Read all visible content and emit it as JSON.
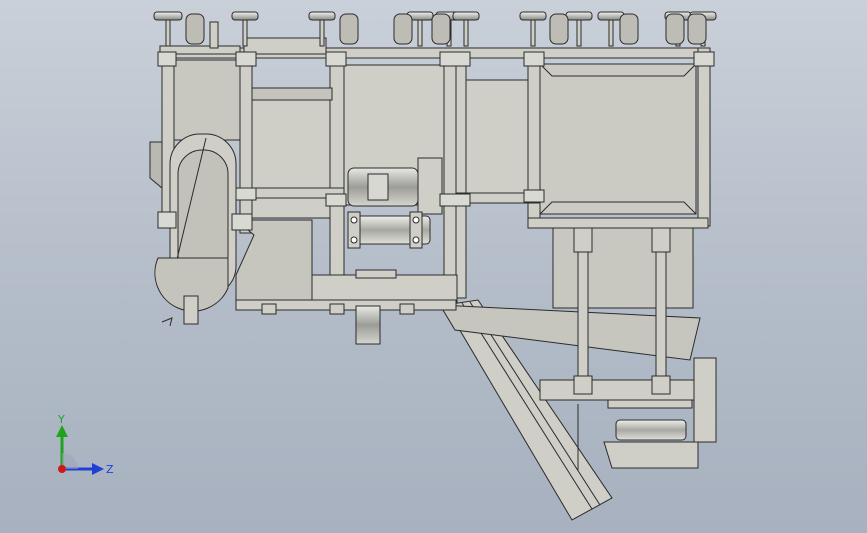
{
  "viewport": {
    "background_top": "#c9d0d9",
    "background_bottom": "#a7b1bf",
    "part_fill": "#cfcfc8",
    "part_fill_dark": "#b9b9b1",
    "edge_color": "#2b2b2b"
  },
  "triad": {
    "y_label": "Y",
    "z_label": "Z",
    "y_color": "#1fa31f",
    "z_color": "#1f3fd6",
    "origin_color": "#d01818"
  }
}
